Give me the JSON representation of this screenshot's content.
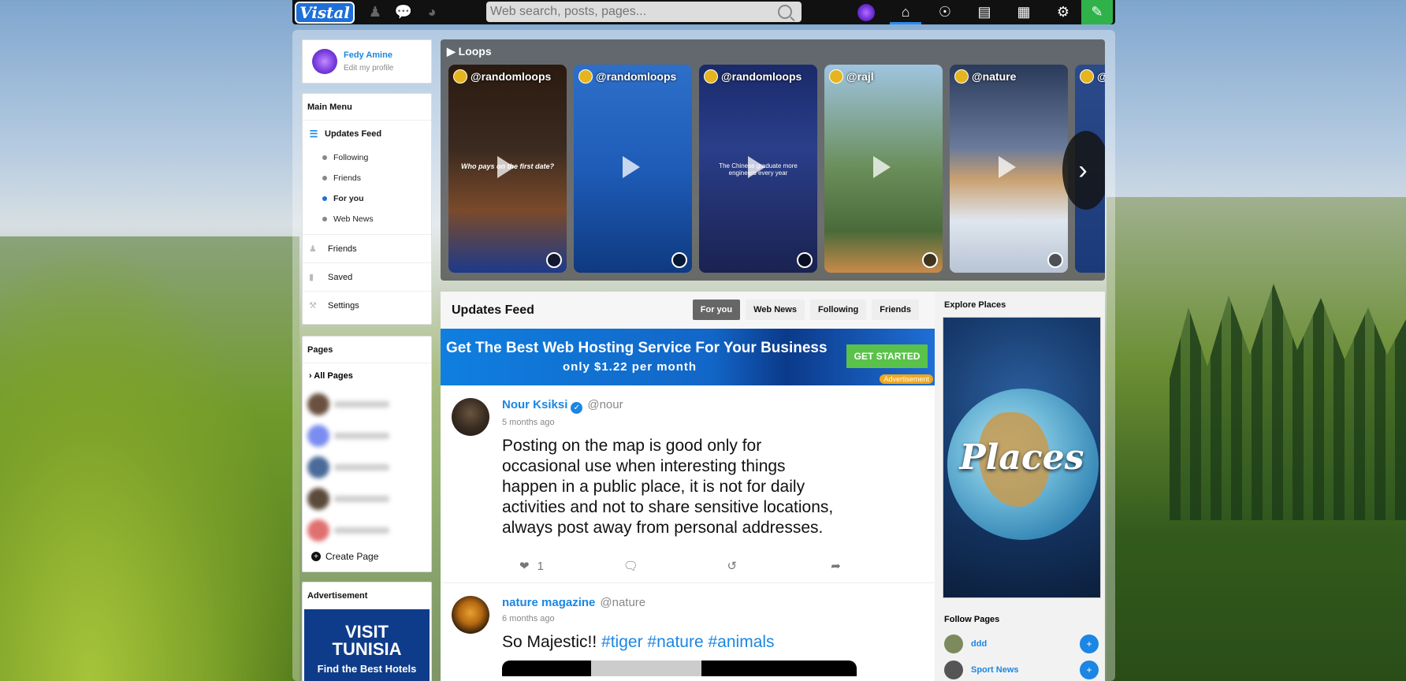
{
  "topbar": {
    "logo": "Vistal",
    "search_placeholder": "Web search, posts, pages..."
  },
  "profile": {
    "name": "Fedy Amine",
    "edit": "Edit my profile"
  },
  "main_menu": {
    "title": "Main Menu",
    "updates_feed": "Updates Feed",
    "sub_items": [
      "Following",
      "Friends",
      "For you",
      "Web News"
    ],
    "active_sub": "For you",
    "friends": "Friends",
    "saved": "Saved",
    "settings": "Settings"
  },
  "pages": {
    "title": "Pages",
    "all_pages": "› All Pages",
    "create": "Create Page"
  },
  "advertisement": {
    "title": "Advertisement",
    "line1": "VISIT",
    "line2": "TUNISIA",
    "line3": "Find the Best Hotels"
  },
  "loops": {
    "title": "Loops",
    "items": [
      {
        "user": "@randomloops",
        "caption": "Who pays on the first date?"
      },
      {
        "user": "@randomloops",
        "caption": ""
      },
      {
        "user": "@randomloops",
        "caption": "The Chinese graduate more engineers every year"
      },
      {
        "user": "@rajl",
        "caption": ""
      },
      {
        "user": "@nature",
        "caption": ""
      },
      {
        "user": "@",
        "caption": ""
      }
    ]
  },
  "feed": {
    "title": "Updates Feed",
    "tabs": [
      "For you",
      "Web News",
      "Following",
      "Friends"
    ],
    "active_tab": "For you",
    "ad": {
      "headline": "Get The Best Web Hosting Service For Your Business",
      "price": "only $1.22 per month",
      "cta": "GET STARTED",
      "tag": "Advertisement"
    },
    "posts": [
      {
        "user": "Nour Ksiksi",
        "verified": true,
        "handle": "@nour",
        "time": "5 months ago",
        "text": "Posting on the map is good only for occasional use when interesting things happen in a public place, it is not for daily activities and not to share sensitive locations, always post away from personal addresses.",
        "likes": "1"
      },
      {
        "user": "nature magazine",
        "handle": "@nature",
        "time": "6 months ago",
        "text": "So Majestic!! ",
        "tags": [
          "#tiger",
          "#nature",
          "#animals"
        ]
      }
    ]
  },
  "rail": {
    "explore_title": "Explore Places",
    "places_label": "Places",
    "follow_title": "Follow Pages",
    "follow_pages": [
      "ddd",
      "Sport News"
    ]
  }
}
